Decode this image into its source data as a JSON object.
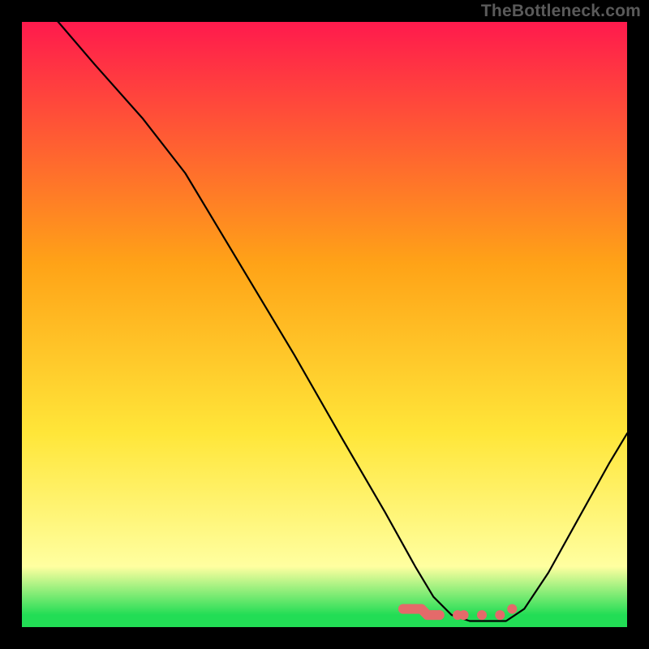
{
  "watermark": "TheBottleneck.com",
  "colors": {
    "bg": "#000000",
    "watermark": "#5a5a5a",
    "grad_top": "#ff1a4d",
    "grad_mid1": "#ffa317",
    "grad_mid2": "#ffe639",
    "grad_mid3": "#ffffa0",
    "grad_bot": "#22dd55",
    "curve": "#000000",
    "marker": "#e46a6a"
  },
  "chart_data": {
    "type": "line",
    "title": "",
    "xlabel": "",
    "ylabel": "",
    "ylim": [
      0,
      100
    ],
    "xlim": [
      0,
      100
    ],
    "series": [
      {
        "name": "bottleneck-curve",
        "x": [
          0,
          6,
          12,
          20,
          27,
          36,
          45,
          53,
          60,
          65,
          68,
          71,
          74,
          77,
          80,
          83,
          87,
          92,
          97,
          100
        ],
        "y": [
          105,
          100,
          93,
          84,
          75,
          60,
          45,
          31,
          19,
          10,
          5,
          2,
          1,
          1,
          1,
          3,
          9,
          18,
          27,
          32
        ]
      }
    ],
    "markers": {
      "name": "highlight-band",
      "x": [
        63,
        64,
        65,
        66,
        67,
        68,
        69,
        72,
        73,
        76,
        79,
        81
      ],
      "y": [
        3,
        3,
        3,
        3,
        2,
        2,
        2,
        2,
        2,
        2,
        2,
        3
      ]
    }
  }
}
